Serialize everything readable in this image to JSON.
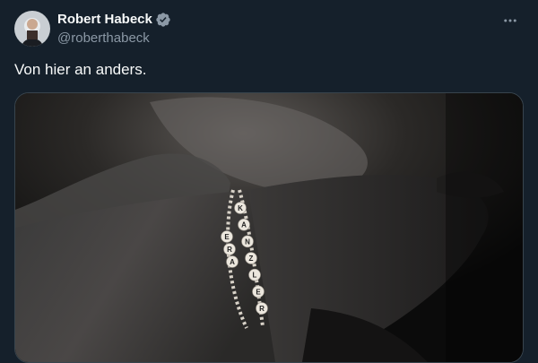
{
  "tweet": {
    "author": {
      "display_name": "Robert Habeck",
      "handle": "@roberthabeck",
      "verified": true,
      "avatar_icon": "profile-photo"
    },
    "more_icon": "more-options-icon",
    "text": "Von hier an anders.",
    "media": {
      "bracelet_letters_top": [
        "K",
        "A",
        "N",
        "Z",
        "L",
        "E",
        "R"
      ],
      "bracelet_letters_bottom": [
        "E",
        "R",
        "A"
      ]
    }
  },
  "colors": {
    "background": "#15202b",
    "text_primary": "#f7f9f9",
    "text_secondary": "#8b98a5",
    "verified": "#8b98a5",
    "border": "#38444d"
  }
}
